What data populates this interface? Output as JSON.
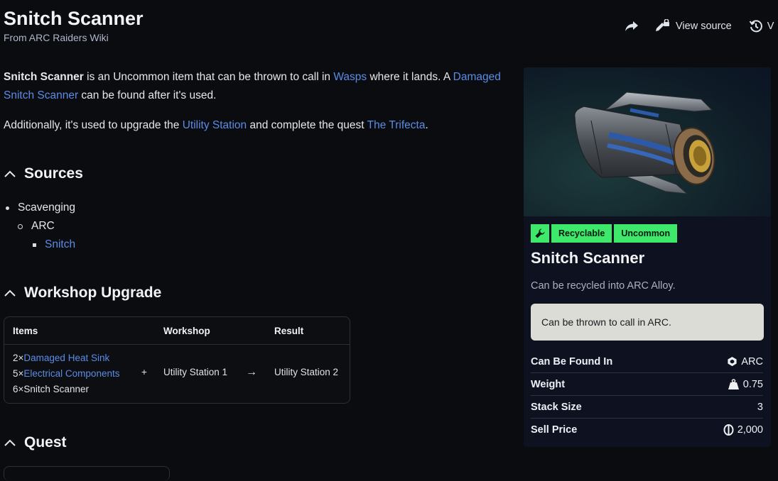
{
  "header": {
    "title": "Snitch Scanner",
    "subtitle": "From ARC Raiders Wiki"
  },
  "actions": {
    "view_source": "View source",
    "history_partial": "V"
  },
  "intro": {
    "p1_name": "Snitch Scanner",
    "p1_a": " is an Uncommon item that can be thrown to call in ",
    "p1_link1": "Wasps",
    "p1_b": " where it lands. A ",
    "p1_link2": "Damaged Snitch Scanner",
    "p1_c": " can be found after it's used.",
    "p2_a": "Additionally, it's used to upgrade the ",
    "p2_link1": "Utility Station",
    "p2_b": " and complete the quest ",
    "p2_link2": "The Trifecta",
    "p2_c": "."
  },
  "sections": {
    "sources": "Sources",
    "workshop": "Workshop Upgrade",
    "quest": "Quest"
  },
  "sources": {
    "level1": "Scavenging",
    "level2": "ARC",
    "level3": "Snitch"
  },
  "workshop_table": {
    "headers": [
      "Items",
      "Workshop",
      "Result"
    ],
    "items": [
      {
        "qty": "2×",
        "name": "Damaged Heat Sink",
        "link": true
      },
      {
        "qty": "5×",
        "name": "Electrical Components",
        "link": true
      },
      {
        "qty": "6×",
        "name": "Snitch Scanner",
        "link": false
      }
    ],
    "plus": "+",
    "workshop": "Utility Station 1",
    "arrow": "→",
    "result": "Utility Station 2"
  },
  "infobox": {
    "tags": [
      "Recyclable",
      "Uncommon"
    ],
    "title": "Snitch Scanner",
    "recycle_text": "Can be recycled into ARC Alloy.",
    "callout": "Can be thrown to call in ARC.",
    "stats": [
      {
        "label": "Can Be Found In",
        "value": "ARC",
        "icon": "arc-icon"
      },
      {
        "label": "Weight",
        "value": "0.75",
        "icon": "weight-icon"
      },
      {
        "label": "Stack Size",
        "value": "3",
        "icon": ""
      },
      {
        "label": "Sell Price",
        "value": "2,000",
        "icon": "coin-icon"
      }
    ],
    "tag_color": "#3ee86a"
  },
  "colors": {
    "link": "#5b8ce6",
    "background": "#0b0c10",
    "infobox_bg": "#0e1220"
  }
}
